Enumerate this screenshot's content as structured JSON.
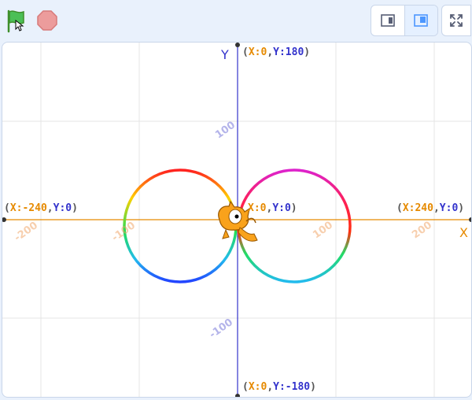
{
  "toolbar": {
    "green_flag_icon": "green-flag-icon",
    "stop_icon": "stop-sign-icon",
    "small_stage_icon": "small-stage-icon",
    "normal_stage_icon": "normal-stage-icon",
    "fullscreen_icon": "fullscreen-icon"
  },
  "stage": {
    "axis_x_name": "X",
    "axis_y_name": "Y",
    "labels": {
      "top": {
        "open": "(",
        "x_key": "X:",
        "x_val": "0",
        "sep": ",",
        "y_key": "Y:",
        "y_val": "180",
        "close": ")"
      },
      "bottom": {
        "open": "(",
        "x_key": "X:",
        "x_val": "0",
        "sep": ",",
        "y_key": "Y:",
        "y_val": "-180",
        "close": ")"
      },
      "left": {
        "open": "(",
        "x_key": "X:",
        "x_val": "-240",
        "sep": ",",
        "y_key": "Y:",
        "y_val": "0",
        "close": ")"
      },
      "right": {
        "open": "(",
        "x_key": "X:",
        "x_val": "240",
        "sep": ",",
        "y_key": "Y:",
        "y_val": "0",
        "close": ")"
      },
      "center": {
        "x_key": "X:",
        "x_val": "0",
        "sep": ",",
        "y_key": "Y:",
        "y_val": "0",
        "close": ")"
      }
    },
    "ticks": {
      "x_neg200": "-200",
      "x_neg100": "-100",
      "x_100": "100",
      "x_200": "200",
      "y_100": "100",
      "y_neg100": "-100"
    },
    "sprite": "cat-sprite",
    "colors": {
      "x_axis": "#e68a00",
      "y_axis": "#3333cc",
      "grid": "#e3e3e3"
    }
  }
}
